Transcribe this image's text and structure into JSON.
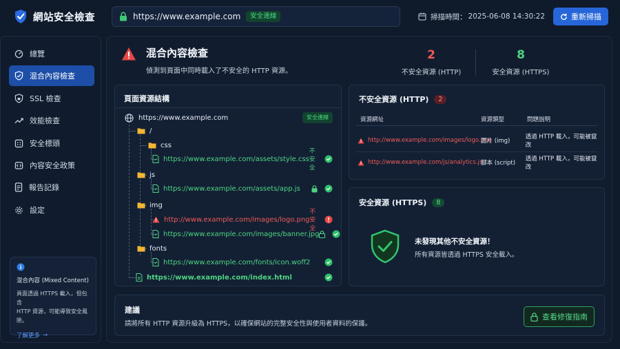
{
  "app": {
    "title": "網站安全檢查"
  },
  "urlbar": {
    "url": "https://www.example.com",
    "status": "安全連線"
  },
  "scan": {
    "label": "掃描時間：",
    "time": "2025-06-08 14:30:22"
  },
  "rescan_label": "重新掃描",
  "sidebar": {
    "items": [
      {
        "label": "總覽",
        "icon": "dashboard-icon"
      },
      {
        "label": "混合內容檢查",
        "icon": "shield-icon"
      },
      {
        "label": "SSL 檢查",
        "icon": "lock-icon"
      },
      {
        "label": "效能檢查",
        "icon": "trend-icon"
      },
      {
        "label": "安全標頭",
        "icon": "header-icon"
      },
      {
        "label": "內容安全政策",
        "icon": "policy-icon"
      },
      {
        "label": "報告記錄",
        "icon": "report-icon"
      },
      {
        "label": "設定",
        "icon": "gear-icon"
      }
    ],
    "active_index": 1,
    "info": {
      "title": "混合內容 (Mixed Content)",
      "text_1": "頁面透過 HTTPS 載入，但包含",
      "text_2": "HTTP 資源，可能導致安全風險。",
      "link": "了解更多"
    }
  },
  "main": {
    "title": "混合內容檢查",
    "subtitle": "偵測到頁面中同時載入了不安全的 HTTP 資源。",
    "stats": {
      "insecure": {
        "value": "2",
        "label": "不安全資源 (HTTP)"
      },
      "secure": {
        "value": "8",
        "label": "安全資源 (HTTPS)"
      }
    }
  },
  "tree": {
    "title": "頁面資源結構",
    "root": {
      "url": "https://www.example.com",
      "badge": "安全連線"
    },
    "folders": {
      "root": "/",
      "css": "css",
      "js": "js",
      "img": "img",
      "fonts": "fonts"
    },
    "files": [
      {
        "url": "https://www.example.com/assets/style.css",
        "status": "不安全",
        "secure": true
      },
      {
        "url": "https://www.example.com/assets/app.js",
        "secure": true
      },
      {
        "url": "http://www.example.com/images/logo.png",
        "status": "不安全",
        "secure": false
      },
      {
        "url": "https://www.example.com/images/banner.jpg",
        "secure": true
      },
      {
        "url": "https://www.example.com/fonts/icon.woff2",
        "secure": true
      },
      {
        "url": "https://www.example.com/index.html",
        "secure": true
      }
    ]
  },
  "insecure_table": {
    "title": "不安全資源 (HTTP)",
    "count": "2",
    "headers": [
      "資源網址",
      "資源類型",
      "問題說明"
    ],
    "rows": [
      {
        "url": "http://www.example.com/images/logo.png",
        "type": "圖片 (img)",
        "issue": "透過 HTTP 載入，可能被竄改"
      },
      {
        "url": "http://www.example.com/js/analytics.js",
        "type": "腳本 (script)",
        "issue": "透過 HTTP 載入，可能被竄改"
      }
    ]
  },
  "secure_panel": {
    "title": "安全資源 (HTTPS)",
    "count": "8",
    "heading": "未發現其他不安全資源！",
    "text": "所有資源皆透過 HTTPS 安全載入。"
  },
  "advice": {
    "title": "建議",
    "text": "請將所有 HTTP 資源升級為 HTTPS，以確保網站的完整安全性與使用者資料的保護。",
    "button": "查看修復指南"
  },
  "colors": {
    "accent": "#2766d9",
    "danger": "#ef5a55",
    "success": "#4fd482",
    "background": "#0f1a2a"
  }
}
